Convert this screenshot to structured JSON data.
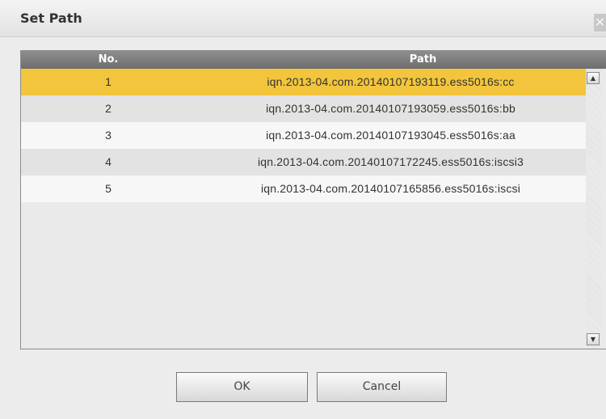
{
  "dialog": {
    "title": "Set Path",
    "close_icon": "close-icon",
    "close_glyph": "✕"
  },
  "table": {
    "headers": {
      "no": "No.",
      "path": "Path"
    },
    "rows": [
      {
        "no": "1",
        "path": "iqn.2013-04.com.20140107193119.ess5016s:cc",
        "selected": true
      },
      {
        "no": "2",
        "path": "iqn.2013-04.com.20140107193059.ess5016s:bb",
        "selected": false
      },
      {
        "no": "3",
        "path": "iqn.2013-04.com.20140107193045.ess5016s:aa",
        "selected": false
      },
      {
        "no": "4",
        "path": "iqn.2013-04.com.20140107172245.ess5016s:iscsi3",
        "selected": false
      },
      {
        "no": "5",
        "path": "iqn.2013-04.com.20140107165856.ess5016s:iscsi",
        "selected": false
      }
    ],
    "scroll_up_icon": "triangle-up-icon",
    "scroll_down_icon": "triangle-down-icon",
    "scroll_up_glyph": "▲",
    "scroll_down_glyph": "▼"
  },
  "buttons": {
    "ok": "OK",
    "cancel": "Cancel"
  },
  "colors": {
    "selected_row": "#f2c53d",
    "header_bg": "#7e7e7e"
  }
}
